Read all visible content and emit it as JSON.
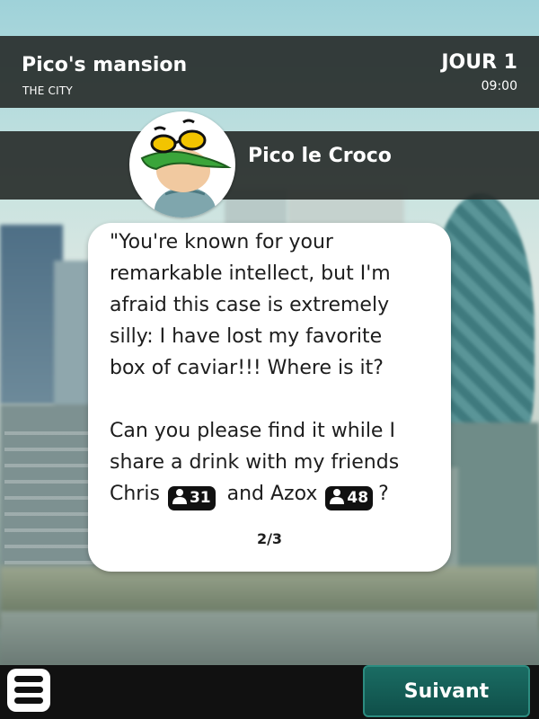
{
  "location": {
    "title": "Pico's mansion",
    "subtitle": "THE CITY",
    "day": "JOUR 1",
    "time": "09:00"
  },
  "speaker": {
    "name": "Pico le Croco",
    "avatar_icon": "crocodile-with-sunglasses-avatar"
  },
  "dialogue": {
    "lines": [
      "\"You're known for your",
      "remarkable intellect, but I'm",
      "afraid this case is extremely",
      "silly: I have lost my favorite",
      "box of caviar!!! Where is it?",
      "Can you please find it while I",
      "share a drink with my friends"
    ],
    "last_line": {
      "friend1_name": "Chris",
      "friend1_count": "31",
      "connector": "and Azox",
      "friend2_count": "48",
      "end": "?"
    },
    "page_indicator": "2/3",
    "badge_icon": "person-icon"
  },
  "footer": {
    "menu_icon": "hamburger-menu-icon",
    "next_label": "Suivant",
    "accent": "#166159"
  }
}
